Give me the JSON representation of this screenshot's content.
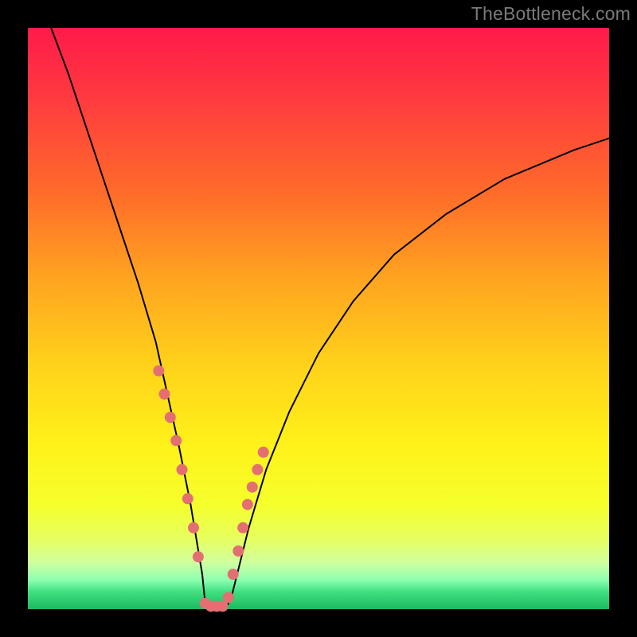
{
  "watermark": "TheBottleneck.com",
  "chart_data": {
    "type": "line",
    "title": "",
    "xlabel": "",
    "ylabel": "",
    "xlim": [
      0,
      100
    ],
    "ylim": [
      0,
      100
    ],
    "legend": false,
    "grid": false,
    "background_gradient": [
      "#ff1a4a",
      "#ff6a2a",
      "#ffd21a",
      "#fff21a",
      "#40e080",
      "#1db860"
    ],
    "series": [
      {
        "name": "bottleneck-curve",
        "x": [
          4,
          7,
          10,
          13,
          16,
          19,
          22,
          24,
          26,
          28,
          30,
          30.5,
          31,
          32,
          33,
          34,
          35,
          36,
          38,
          41,
          45,
          50,
          56,
          63,
          72,
          82,
          94,
          100
        ],
        "values": [
          100,
          92,
          83,
          74,
          65,
          56,
          46,
          37,
          28,
          18,
          6,
          1,
          0,
          0,
          0,
          0,
          2,
          6,
          14,
          24,
          34,
          44,
          53,
          61,
          68,
          74,
          79,
          81
        ]
      }
    ],
    "markers": {
      "name": "highlighted-dots",
      "x": [
        22.5,
        23.5,
        24.5,
        25.5,
        26.5,
        27.5,
        28.5,
        29.3,
        30.5,
        31.5,
        32.5,
        33.5,
        34.5,
        35.3,
        36.2,
        37.0,
        37.8,
        38.6,
        39.5,
        40.5
      ],
      "values": [
        41,
        37,
        33,
        29,
        24,
        19,
        14,
        9,
        1,
        0.5,
        0.5,
        0.5,
        2,
        6,
        10,
        14,
        18,
        21,
        24,
        27
      ],
      "color": "#e46f72",
      "radius_px": 7
    }
  }
}
